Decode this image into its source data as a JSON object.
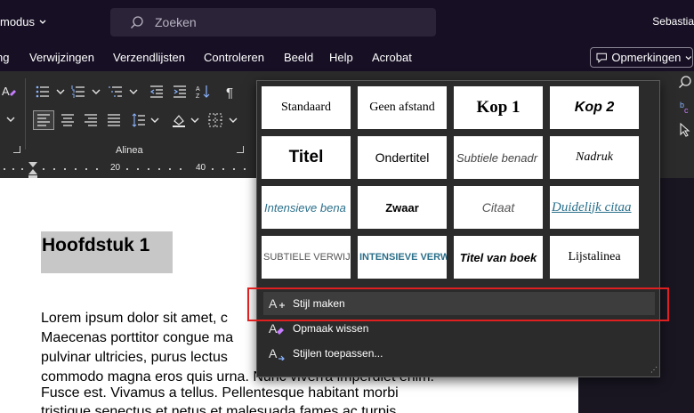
{
  "titlebar": {
    "autosave_fragment": "modus",
    "search_placeholder": "Zoeken",
    "user_fragment": "Sebastia"
  },
  "menu_tabs": [
    "ng",
    "Verwijzingen",
    "Verzendlijsten",
    "Controleren",
    "Beeld",
    "Help",
    "Acrobat"
  ],
  "comments_button": "Opmerkingen",
  "ribbon": {
    "group_label": "Alinea"
  },
  "ruler": {
    "marks": [
      "20",
      "40"
    ]
  },
  "document": {
    "heading": "Hoofdstuk 1",
    "lines": [
      "Lorem ipsum dolor sit amet, c",
      "Maecenas porttitor congue ma",
      "pulvinar ultricies, purus lectus",
      "commodo magna eros quis urna. Nunc viverra imperdiet enim.",
      "Fusce est. Vivamus a tellus. Pellentesque habitant morbi",
      "tristique senectus et netus et malesuada fames ac turpis"
    ]
  },
  "styles_gallery": {
    "rows": [
      [
        "Standaard",
        "Geen afstand",
        "Kop 1",
        "Kop 2"
      ],
      [
        "Titel",
        "Ondertitel",
        "Subtiele benadr",
        "Nadruk"
      ],
      [
        "Intensieve bena",
        "Zwaar",
        "Citaat",
        "Duidelijk citaa"
      ],
      [
        "SUBTIELE VERWIJZ",
        "INTENSIEVE VERW",
        "Titel van boek",
        "Lijstalinea"
      ]
    ],
    "menu": [
      {
        "label": "Stijl maken"
      },
      {
        "label": "Opmaak wissen"
      },
      {
        "label": "Stijlen toepassen..."
      }
    ]
  },
  "colors": {
    "accent_highlight": "#e02020",
    "title_bar": "#170f24",
    "ribbon": "#2b2b2b"
  }
}
